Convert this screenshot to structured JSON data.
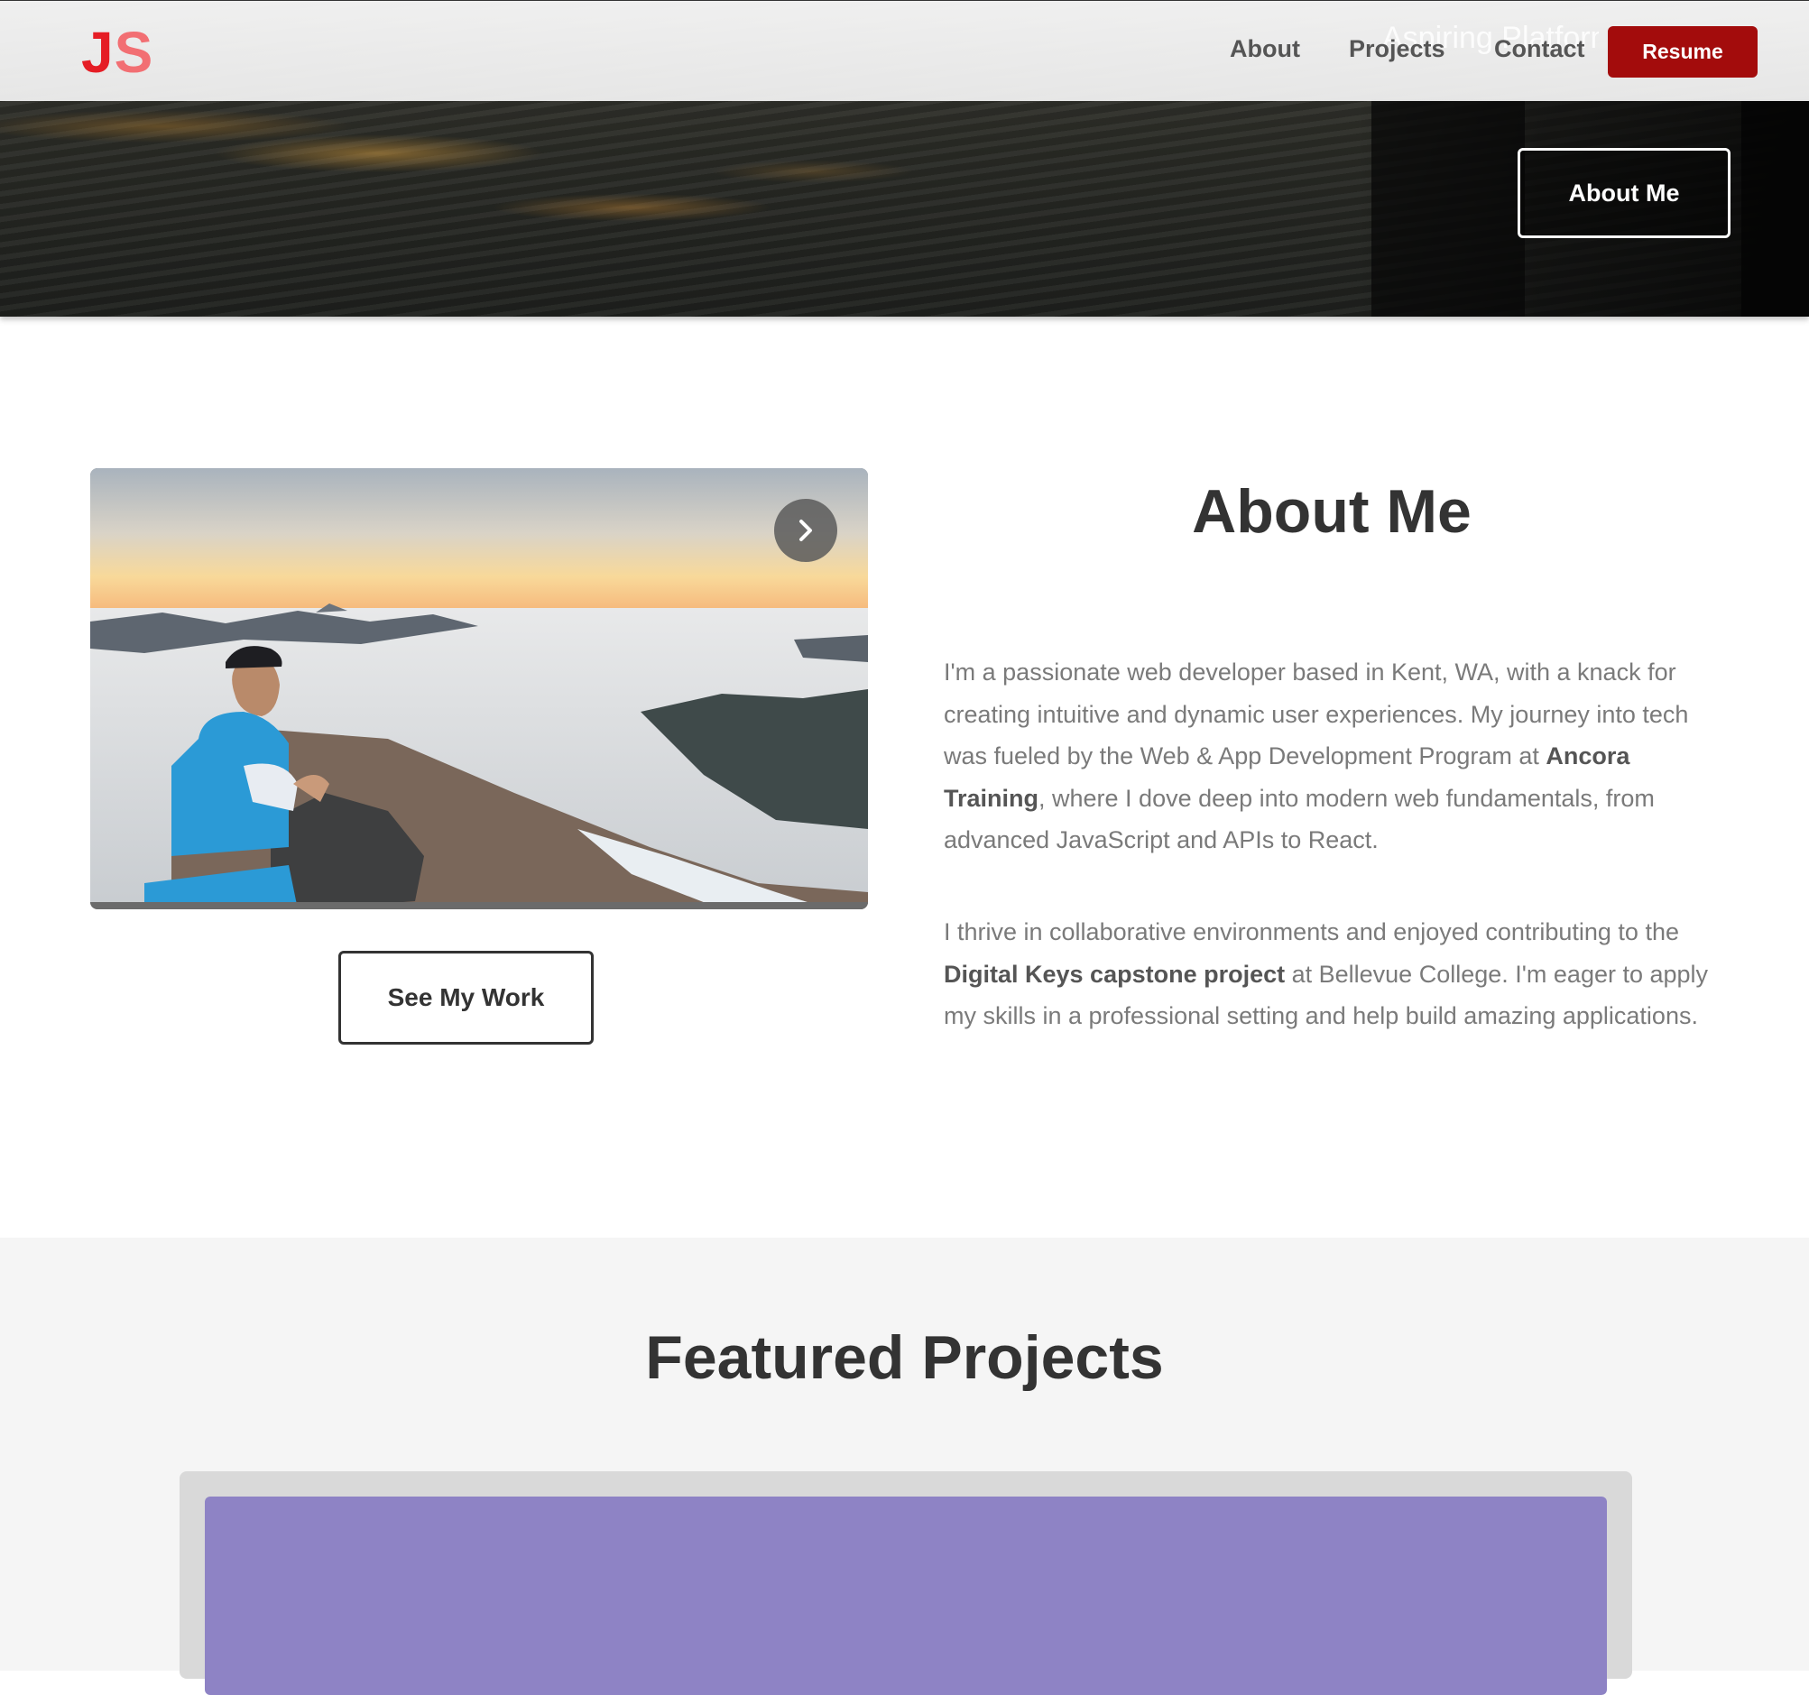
{
  "nav": {
    "logo_j": "J",
    "logo_s": "S",
    "tagline": "Aspiring Platform",
    "links": [
      "About",
      "Projects",
      "Contact"
    ],
    "resume_label": "Resume"
  },
  "hero": {
    "button_label": "About Me"
  },
  "about": {
    "title": "About Me",
    "p1": {
      "text_a": "I'm a passionate web developer based in Kent, WA, with a knack for creating intuitive and dynamic user experiences. My journey into tech was fueled by the Web & App Development Program at ",
      "bold": "Ancora Training",
      "text_b": ", where I dove deep into modern web fundamentals, from advanced JavaScript and APIs to React."
    },
    "p2": {
      "text_a": "I thrive in collaborative environments and enjoyed contributing to the ",
      "bold": "Digital Keys capstone project",
      "text_b": " at Bellevue College. I'm eager to apply my skills in a professional setting and help build amazing applications."
    },
    "see_work_label": "See My Work"
  },
  "featured": {
    "title": "Featured Projects"
  },
  "colors": {
    "brand_red": "#a30c0c",
    "logo_j": "#e51d25",
    "logo_s": "#f26f73",
    "project_card": "#8e83c5"
  },
  "icons": [
    "chevron-right-icon"
  ]
}
